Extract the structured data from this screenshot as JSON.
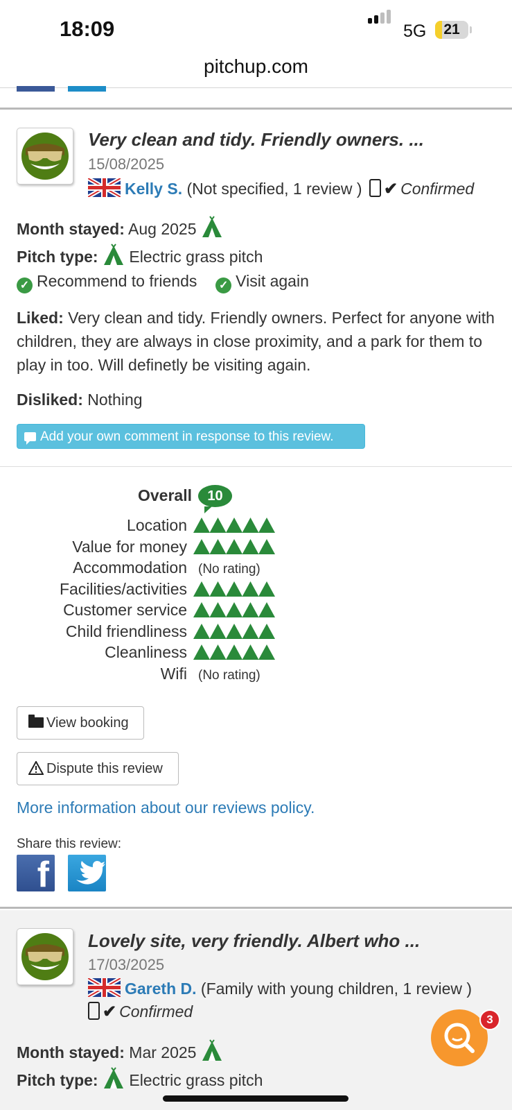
{
  "status_bar": {
    "time": "18:09",
    "network": "5G",
    "battery": "21",
    "battery_level": 0.21
  },
  "browser": {
    "url": "pitchup.com"
  },
  "reviews": [
    {
      "title": "Very clean and tidy. Friendly owners. ...",
      "date": "15/08/2025",
      "reviewer_name": "Kelly S.",
      "reviewer_info": "(Not specified, 1 review )",
      "confirmed": "Confirmed",
      "month_stayed_label": "Month stayed:",
      "month_stayed": "Aug 2025",
      "pitch_type_label": "Pitch type:",
      "pitch_type": "Electric grass pitch",
      "recommend": "Recommend to friends",
      "visit_again": "Visit again",
      "liked_label": "Liked:",
      "liked": "Very clean and tidy. Friendly owners. Perfect for anyone with children, they are always in close proximity, and a park for them to play in too. Will definetly be visiting again.",
      "disliked_label": "Disliked:",
      "disliked": "Nothing",
      "comment_button": "Add your own comment in response to this review.",
      "overall_label": "Overall",
      "overall_score": "10",
      "ratings": [
        {
          "label": "Location",
          "value": 5,
          "text": ""
        },
        {
          "label": "Value for money",
          "value": 5,
          "text": ""
        },
        {
          "label": "Accommodation",
          "value": null,
          "text": "(No rating)"
        },
        {
          "label": "Facilities/activities",
          "value": 5,
          "text": ""
        },
        {
          "label": "Customer service",
          "value": 5,
          "text": ""
        },
        {
          "label": "Child friendliness",
          "value": 5,
          "text": ""
        },
        {
          "label": "Cleanliness",
          "value": 5,
          "text": ""
        },
        {
          "label": "Wifi",
          "value": null,
          "text": "(No rating)"
        }
      ],
      "view_booking": "View booking",
      "dispute": "Dispute this review",
      "policy_link": "More information about our reviews policy.",
      "share_label": "Share this review:"
    },
    {
      "title": "Lovely site, very friendly. Albert who ...",
      "date": "17/03/2025",
      "reviewer_name": "Gareth D.",
      "reviewer_info": "(Family with young children, 1 review )",
      "confirmed": "Confirmed",
      "month_stayed_label": "Month stayed:",
      "month_stayed": "Mar 2025",
      "pitch_type_label": "Pitch type:",
      "pitch_type": "Electric grass pitch"
    }
  ],
  "fab": {
    "badge": "3",
    "icon": "search-icon"
  },
  "colors": {
    "link": "#2c7bb6",
    "green": "#2a8a3a",
    "comment_btn": "#5bc0de",
    "fab": "#f7972d"
  }
}
